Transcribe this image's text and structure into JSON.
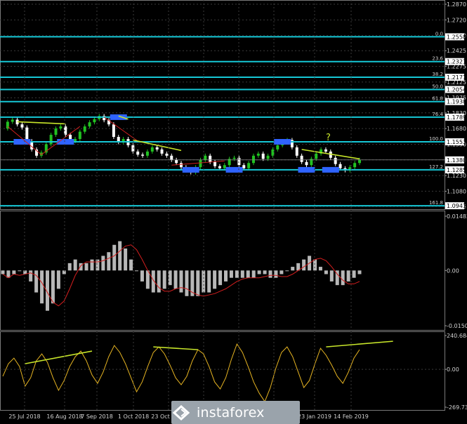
{
  "chart_data": [
    {
      "type": "line",
      "title": "",
      "y_ticks": [
        "1.2870",
        "1.2720",
        "1.2570",
        "1.2425",
        "1.2275",
        "1.2125",
        "1.1975",
        "1.1830",
        "1.1680",
        "1.1530",
        "1.1380",
        "1.1230",
        "1.1080",
        "1.0935"
      ],
      "ylim": [
        1.0935,
        1.287
      ],
      "x_ticks": [
        "25 Jul 2018",
        "16 Aug 2018",
        "7 Sep 2018",
        "1 Oct 2018",
        "23 Oct 2018",
        "",
        "",
        "",
        "23 Jan 2019",
        "14 Feb 2019"
      ],
      "grid": true,
      "fib_levels": [
        {
          "label": "0.0",
          "value": "1.2558"
        },
        {
          "label": "23.6",
          "value": "1.2321"
        },
        {
          "label": "38.2",
          "value": "1.2171"
        },
        {
          "label": "50.0",
          "value": "1.2054"
        },
        {
          "label": "61.8",
          "value": "1.1938"
        },
        {
          "label": "76.4",
          "value": "1.1789"
        },
        {
          "label": "100.0",
          "value": "1.1553"
        },
        {
          "label": "127.2",
          "value": "1.1285"
        },
        {
          "label": "161.8",
          "value": "1.0941"
        }
      ],
      "current_price": "1.1380",
      "annotation": "?",
      "colors": {
        "fib": "#16c8d6",
        "trendline": "#c8e62a",
        "up_candle": "#21c221",
        "down_candle": "#ffffff",
        "support_box": "#2f63ff",
        "pattern_line": "#d21e1e",
        "badge_bg": "#ffffff",
        "badge_text": "#000000"
      },
      "price_series": [
        1.168,
        1.1745,
        1.1765,
        1.172,
        1.169,
        1.156,
        1.148,
        1.142,
        1.145,
        1.153,
        1.162,
        1.168,
        1.17,
        1.162,
        1.156,
        1.158,
        1.165,
        1.17,
        1.174,
        1.177,
        1.18,
        1.176,
        1.172,
        1.16,
        1.155,
        1.158,
        1.152,
        1.146,
        1.143,
        1.142,
        1.146,
        1.15,
        1.148,
        1.144,
        1.142,
        1.138,
        1.135,
        1.131,
        1.128,
        1.126,
        1.131,
        1.138,
        1.142,
        1.136,
        1.132,
        1.13,
        1.133,
        1.139,
        1.14,
        1.133,
        1.13,
        1.135,
        1.142,
        1.144,
        1.139,
        1.142,
        1.148,
        1.152,
        1.156,
        1.157,
        1.15,
        1.142,
        1.136,
        1.133,
        1.139,
        1.144,
        1.148,
        1.146,
        1.14,
        1.134,
        1.13,
        1.128,
        1.131,
        1.135,
        1.138
      ]
    },
    {
      "type": "bar",
      "title": "",
      "y_ticks": [
        "0.01482",
        "0.00",
        "-0.01509"
      ],
      "ylim": [
        -0.01509,
        0.01482
      ],
      "values": [
        -0.001,
        -0.002,
        -0.001,
        0.0,
        -0.001,
        -0.003,
        -0.006,
        -0.009,
        -0.011,
        -0.009,
        -0.005,
        -0.001,
        0.002,
        0.003,
        0.002,
        0.002,
        0.003,
        0.003,
        0.004,
        0.005,
        0.007,
        0.008,
        0.006,
        0.003,
        0.0,
        -0.003,
        -0.005,
        -0.006,
        -0.006,
        -0.005,
        -0.004,
        -0.005,
        -0.006,
        -0.007,
        -0.007,
        -0.007,
        -0.006,
        -0.006,
        -0.005,
        -0.004,
        -0.003,
        -0.002,
        -0.002,
        -0.002,
        -0.002,
        -0.002,
        -0.001,
        -0.001,
        -0.002,
        -0.002,
        -0.001,
        0.0,
        0.001,
        0.002,
        0.003,
        0.004,
        0.003,
        0.001,
        -0.001,
        -0.003,
        -0.004,
        -0.004,
        -0.003,
        -0.002,
        -0.001
      ]
    },
    {
      "type": "line",
      "title": "",
      "y_ticks": [
        "240.6846",
        "0.00",
        "-269.7345"
      ],
      "ylim": [
        -269.7345,
        240.6846
      ],
      "values": [
        -50,
        40,
        80,
        20,
        -120,
        -60,
        60,
        110,
        50,
        -60,
        -150,
        -80,
        20,
        90,
        130,
        60,
        -40,
        -100,
        -20,
        90,
        170,
        120,
        40,
        -60,
        -160,
        -90,
        20,
        120,
        160,
        110,
        30,
        -60,
        -110,
        -50,
        60,
        140,
        110,
        20,
        -90,
        -140,
        -60,
        70,
        180,
        120,
        20,
        -90,
        -170,
        -230,
        -130,
        10,
        120,
        160,
        90,
        -20,
        -130,
        -80,
        40,
        150,
        100,
        30,
        -50,
        -100,
        -20,
        80,
        140
      ]
    }
  ],
  "watermark": {
    "brand": "instaforex"
  }
}
